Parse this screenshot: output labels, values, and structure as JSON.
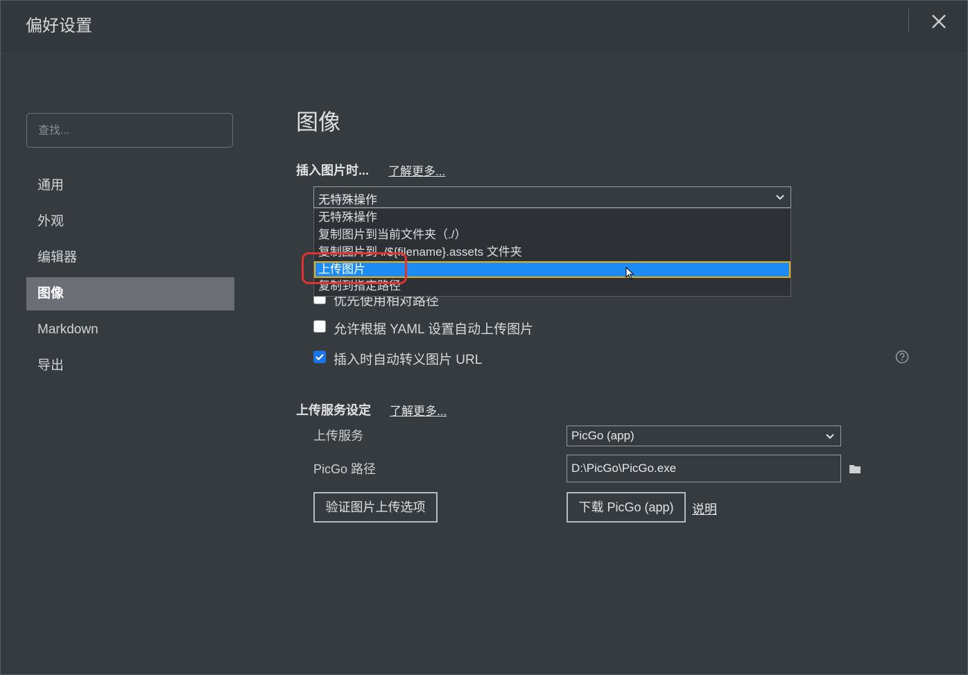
{
  "window": {
    "title": "偏好设置"
  },
  "search": {
    "placeholder": "查找..."
  },
  "sidebar": {
    "items": [
      {
        "label": "通用"
      },
      {
        "label": "外观"
      },
      {
        "label": "编辑器"
      },
      {
        "label": "图像",
        "active": true
      },
      {
        "label": "Markdown"
      },
      {
        "label": "导出"
      }
    ]
  },
  "main": {
    "heading": "图像",
    "insert_section": {
      "title": "插入图片时...",
      "learn_more": "了解更多...",
      "select_value": "无特殊操作",
      "options": [
        "无特殊操作",
        "复制图片到当前文件夹（./）",
        "复制图片到 ./${filename}.assets 文件夹",
        "上传图片",
        "复制到指定路径"
      ],
      "highlighted_option": "上传图片"
    },
    "checkboxes": [
      {
        "label": "优先使用相对路径",
        "checked": false
      },
      {
        "label": "允许根据 YAML 设置自动上传图片",
        "checked": false
      },
      {
        "label": "插入时自动转义图片 URL",
        "checked": true
      }
    ],
    "upload_section": {
      "title": "上传服务设定",
      "learn_more": "了解更多...",
      "service_label": "上传服务",
      "service_value": "PicGo (app)",
      "path_label": "PicGo 路径",
      "path_value": "D:\\PicGo\\PicGo.exe",
      "verify_button": "验证图片上传选项",
      "download_button": "下载 PicGo (app)",
      "doc_link": "说明"
    }
  },
  "colors": {
    "background": "#363b40",
    "accent": "#1e8bf5",
    "annotation": "#e2322f",
    "checkbox_checked": "#1a73e8"
  }
}
